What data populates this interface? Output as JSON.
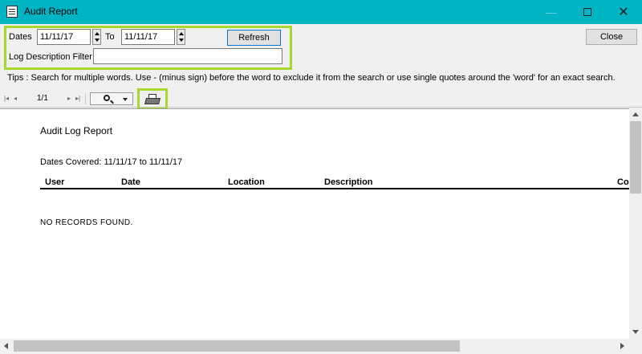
{
  "window": {
    "title": "Audit Report",
    "minimize": "—",
    "close": "✕"
  },
  "filters": {
    "dates_label": "Dates",
    "from_date": "11/11/17",
    "to_label": "To",
    "to_date": "11/11/17",
    "refresh_label": "Refresh",
    "close_label": "Close",
    "log_filter_label": "Log Description Filter",
    "log_filter_value": "",
    "tips": "Tips : Search for multiple words. Use - (minus sign) before the word to exclude it from the search or use single quotes around the 'word' for an exact search."
  },
  "toolbar": {
    "first": "|◂",
    "prev": "◂",
    "page": "1/1",
    "next": "▸",
    "last": "▸|",
    "icons": [
      "first-page-icon",
      "prev-page-icon",
      "next-page-icon",
      "last-page-icon",
      "zoom-icon",
      "print-icon"
    ]
  },
  "report": {
    "title": "Audit Log Report",
    "dates_covered": "Dates Covered: 11/11/17 to 11/11/17",
    "columns": [
      "User",
      "Date",
      "Location",
      "Description",
      "Co"
    ],
    "empty_message": "NO RECORDS FOUND."
  },
  "colors": {
    "titlebar": "#00b4c4",
    "highlight": "#a6d82e",
    "focus_border": "#0078d7"
  }
}
